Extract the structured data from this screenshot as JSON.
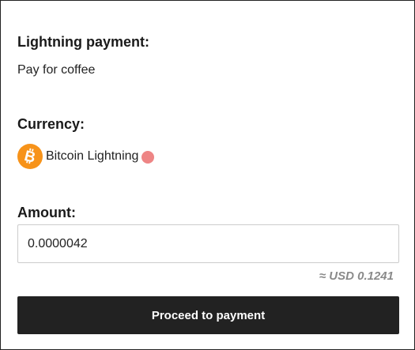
{
  "payment": {
    "title": "Lightning payment:",
    "description": "Pay for coffee"
  },
  "currency": {
    "title": "Currency:",
    "name": "Bitcoin Lightning",
    "icon": "bitcoin-icon",
    "icon_color": "#f7931a",
    "status_color": "#ee8585"
  },
  "amount": {
    "title": "Amount:",
    "value": "0.0000042",
    "usd_estimate": "≈ USD 0.1241"
  },
  "actions": {
    "proceed_label": "Proceed to payment",
    "button_color": "#222222"
  }
}
